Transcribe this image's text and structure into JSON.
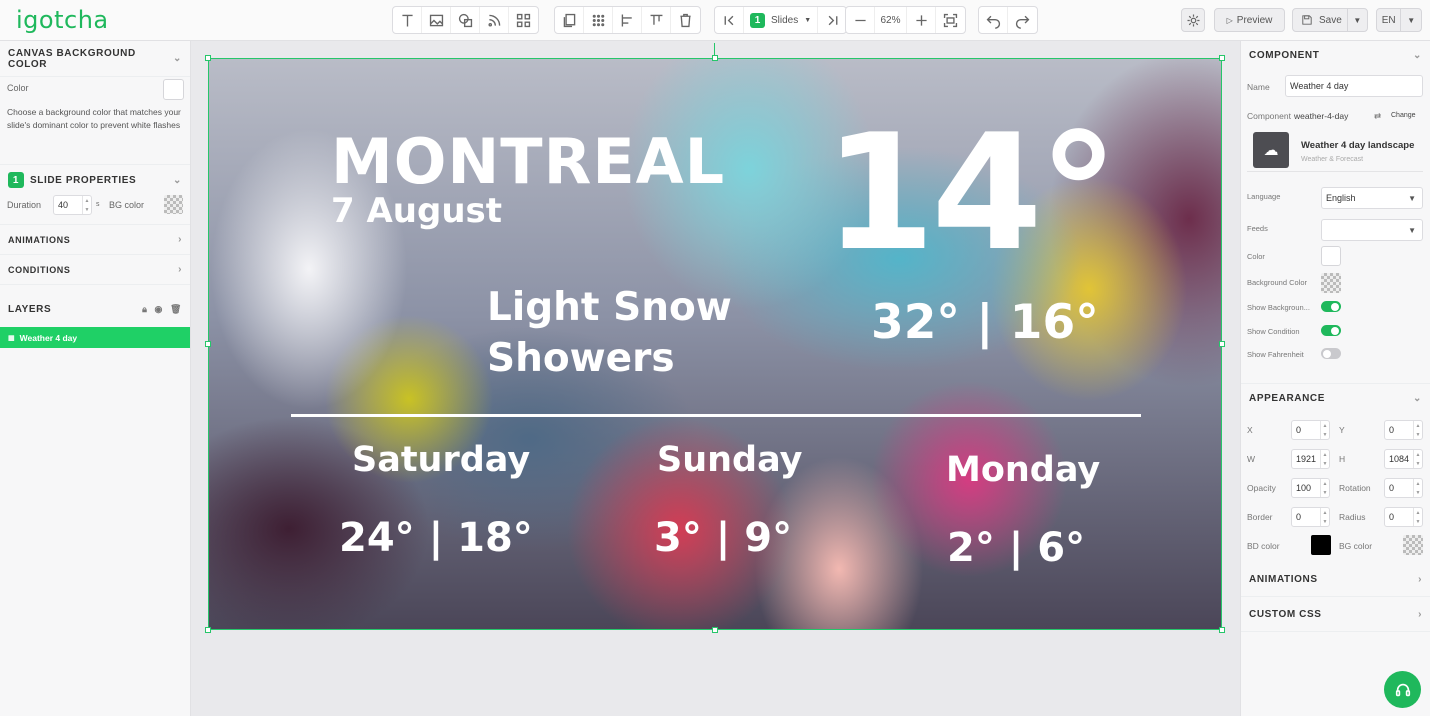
{
  "app": {
    "logo": "igotcha"
  },
  "toolbar": {
    "slides_label": "Slides",
    "page_number": "1",
    "zoom": "62%",
    "preview_label": "Preview",
    "save_label": "Save",
    "lang_label": "EN"
  },
  "left": {
    "canvas_bg_title": "CANVAS BACKGROUND COLOR",
    "color_label": "Color",
    "canvas_bg_help": "Choose a background color that matches your slide's dominant color to prevent white flashes",
    "slide_badge": "1",
    "slide_props_title": "SLIDE PROPERTIES",
    "duration_label": "Duration",
    "duration_value": "40",
    "duration_unit": "s",
    "bgcolor_label": "BG color",
    "animations_title": "ANIMATIONS",
    "conditions_title": "CONDITIONS",
    "layers_title": "LAYERS",
    "layers": [
      {
        "label": "Weather 4 day"
      }
    ]
  },
  "canvas": {
    "city": "MONTREAL",
    "date": "7 August",
    "temp": "14°",
    "condition_line1": "Light Snow",
    "condition_line2": "Showers",
    "hilo": "32° | 16°",
    "days": [
      {
        "name": "Saturday",
        "temps": "24° | 18°"
      },
      {
        "name": "Sunday",
        "temps": "3° | 9°"
      },
      {
        "name": "Monday",
        "temps": "2° | 6°"
      }
    ]
  },
  "right": {
    "component_title": "COMPONENT",
    "name_label": "Name",
    "name_value": "Weather 4 day",
    "component_label": "Component",
    "component_value": "weather-4-day",
    "change_label": "Change",
    "comp_title": "Weather 4 day landscape",
    "comp_sub": "Weather & Forecast",
    "language_label": "Language",
    "language_value": "English",
    "feeds_label": "Feeds",
    "color_label": "Color",
    "bgcolor_label": "Background Color",
    "show_background_label": "Show Backgroun...",
    "show_condition_label": "Show Condition",
    "show_fahrenheit_label": "Show Fahrenheit",
    "appearance_title": "APPEARANCE",
    "x_label": "X",
    "x_value": "0",
    "y_label": "Y",
    "y_value": "0",
    "w_label": "W",
    "w_value": "1921",
    "h_label": "H",
    "h_value": "1084",
    "opacity_label": "Opacity",
    "opacity_value": "100",
    "rotation_label": "Rotation",
    "rotation_value": "0",
    "border_label": "Border",
    "border_value": "0",
    "radius_label": "Radius",
    "radius_value": "0",
    "bdcolor_label": "BD color",
    "bgcolor2_label": "BG color",
    "animations_title": "ANIMATIONS",
    "custom_css_title": "CUSTOM CSS"
  },
  "colors": {
    "accent": "#1fb85c",
    "selection": "#26c66a",
    "toggle_on": "#1fb85c",
    "toggle_off": "#c9c9cd"
  }
}
